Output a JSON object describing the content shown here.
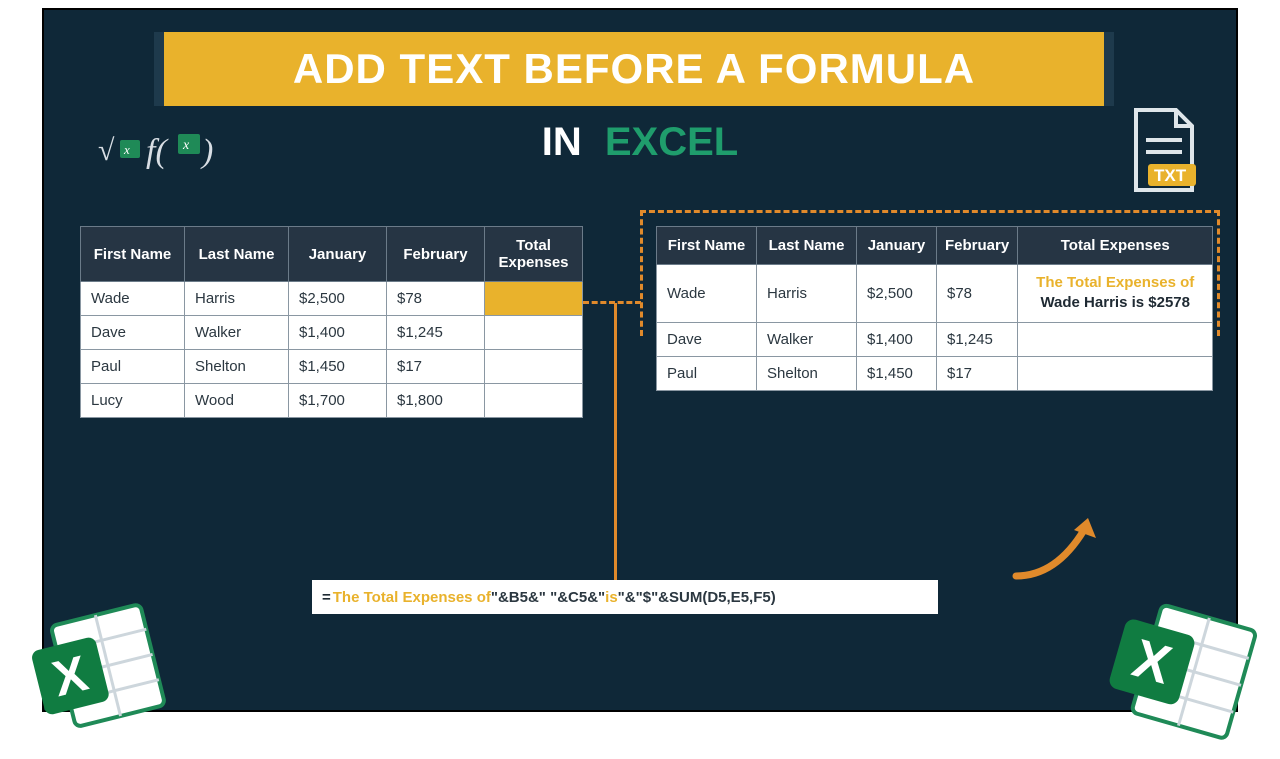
{
  "title": "ADD TEXT BEFORE A FORMULA",
  "subtitle": {
    "in": "IN",
    "excel": "EXCEL"
  },
  "icons": {
    "fx": "formula-fx-icon",
    "txt_label": "TXT",
    "excel_glyph": "X"
  },
  "left_table": {
    "headers": [
      "First Name",
      "Last Name",
      "January",
      "February",
      "Total Expenses"
    ],
    "rows": [
      {
        "first": "Wade",
        "last": "Harris",
        "jan": "$2,500",
        "feb": "$78",
        "total": ""
      },
      {
        "first": "Dave",
        "last": "Walker",
        "jan": "$1,400",
        "feb": "$1,245",
        "total": ""
      },
      {
        "first": "Paul",
        "last": "Shelton",
        "jan": "$1,450",
        "feb": "$17",
        "total": ""
      },
      {
        "first": "Lucy",
        "last": "Wood",
        "jan": "$1,700",
        "feb": "$1,800",
        "total": ""
      }
    ]
  },
  "right_table": {
    "headers": [
      "First Name",
      "Last Name",
      "January",
      "February",
      "Total Expenses"
    ],
    "rows": [
      {
        "first": "Wade",
        "last": "Harris",
        "jan": "$2,500",
        "feb": "$78",
        "result_line1": "The Total Expenses of",
        "result_line2": "Wade Harris is $2578"
      },
      {
        "first": "Dave",
        "last": "Walker",
        "jan": "$1,400",
        "feb": "$1,245",
        "result_line1": "",
        "result_line2": ""
      },
      {
        "first": "Paul",
        "last": "Shelton",
        "jan": "$1,450",
        "feb": "$17",
        "result_line1": "",
        "result_line2": ""
      }
    ]
  },
  "formula": {
    "eq": "=",
    "lit1": "The Total Expenses of ",
    "seg1": "\"&B5&\" \"&C5&\" ",
    "lit2": "is ",
    "seg2": "\"&\"$\"&SUM(D5,E5,F5)"
  }
}
